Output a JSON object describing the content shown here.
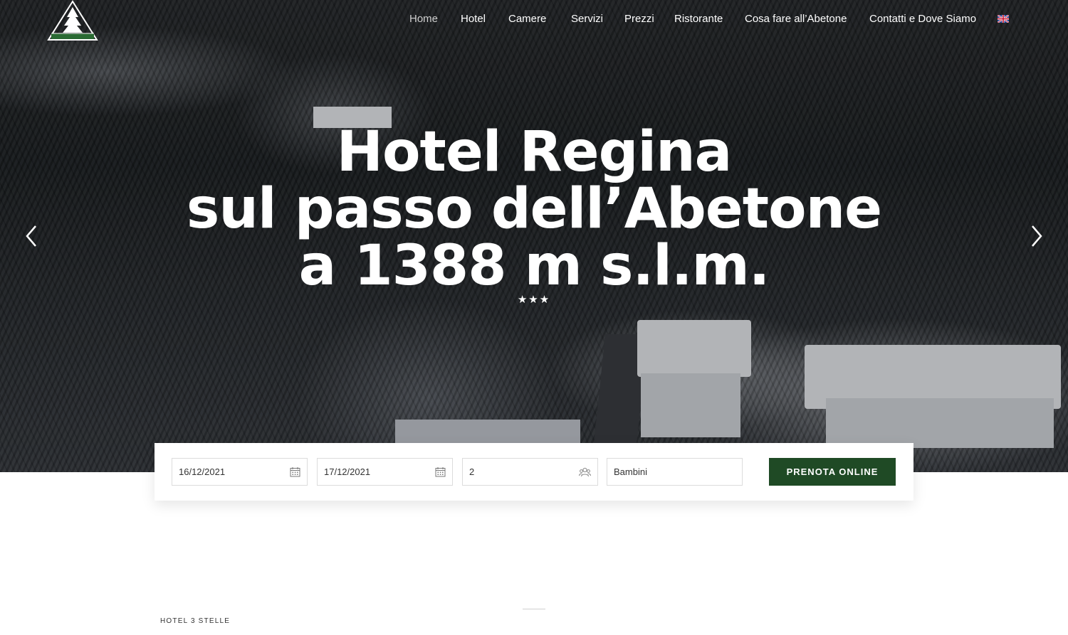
{
  "brand": {
    "logo_name": "Albergo Regina Abetone"
  },
  "nav": {
    "items": [
      {
        "label": "Home",
        "active": true
      },
      {
        "label": "Hotel"
      },
      {
        "label": "Camere"
      },
      {
        "label": "Servizi"
      },
      {
        "label": "Prezzi"
      },
      {
        "label": "Ristorante"
      },
      {
        "label": "Cosa fare all’Abetone"
      },
      {
        "label": "Contatti e Dove Siamo"
      }
    ],
    "language_icon": "uk-flag-icon"
  },
  "hero": {
    "line1": "Hotel Regina",
    "line2": "sul passo dell’Abetone",
    "line3": "a 1388 m s.l.m.",
    "stars": "★★★"
  },
  "booking": {
    "checkin": "16/12/2021",
    "checkout": "17/12/2021",
    "adults": "2",
    "children_placeholder": "Bambini",
    "button_label": "PRENOTA ONLINE"
  },
  "section": {
    "label": "HOTEL 3 STELLE"
  },
  "colors": {
    "accent": "#1f4a25"
  }
}
